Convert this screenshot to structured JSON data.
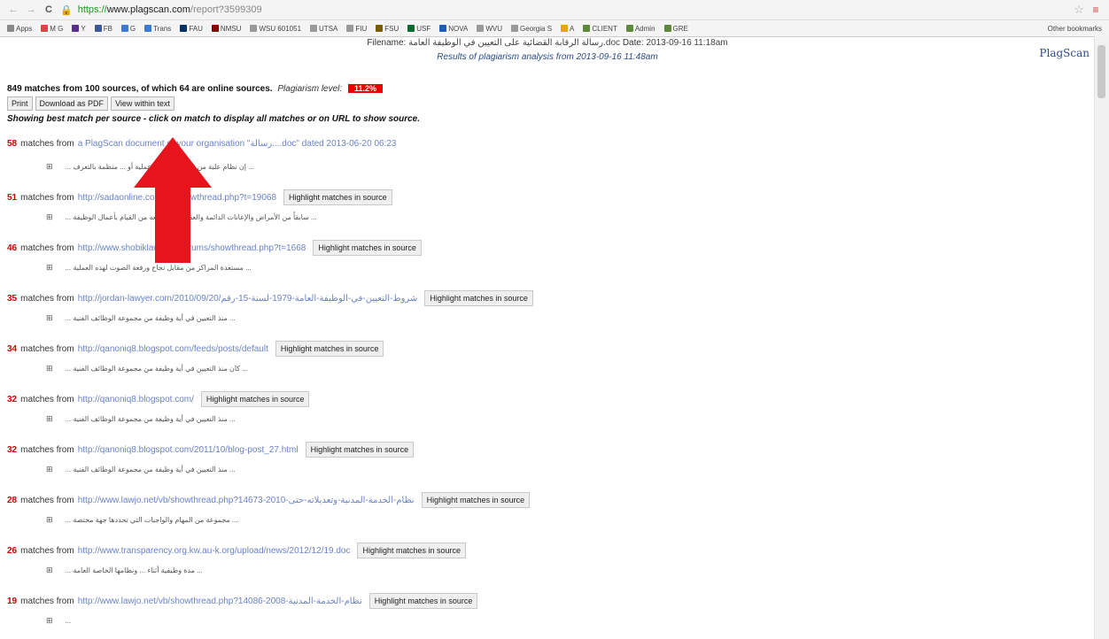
{
  "browser": {
    "url_proto": "https://",
    "url_host": "www.plagscan.com",
    "url_path": "/report?3599309",
    "bookmarks": [
      {
        "label": "Apps",
        "color": "#888"
      },
      {
        "label": "M G",
        "color": "#d44"
      },
      {
        "label": "Y",
        "color": "#5a2d91"
      },
      {
        "label": "FB",
        "color": "#3b5998"
      },
      {
        "label": "G",
        "color": "#3b7bd4"
      },
      {
        "label": "Trans",
        "color": "#3b7bd4"
      },
      {
        "label": "FAU",
        "color": "#003366"
      },
      {
        "label": "NMSU",
        "color": "#8b0000"
      },
      {
        "label": "WSU 601051",
        "color": "#999"
      },
      {
        "label": "UTSA",
        "color": "#999"
      },
      {
        "label": "FIU",
        "color": "#999"
      },
      {
        "label": "FSU",
        "color": "#7a5c00"
      },
      {
        "label": "USF",
        "color": "#0a6b2e"
      },
      {
        "label": "NOVA",
        "color": "#1a5fb4"
      },
      {
        "label": "WVU",
        "color": "#999"
      },
      {
        "label": "Georgia S",
        "color": "#999"
      },
      {
        "label": "A",
        "color": "#e8a317"
      },
      {
        "label": "CLIENT",
        "color": "#5c8a3a"
      },
      {
        "label": "Admin",
        "color": "#5c8a3a"
      },
      {
        "label": "GRE",
        "color": "#5c8a3a"
      }
    ],
    "other_bookmarks": "Other bookmarks"
  },
  "header": {
    "filename_label": "Filename:",
    "filename": "رسالة الرقابة القضائية على التعيين في الوظيفة العامة.doc",
    "date_label": "Date:",
    "date": "2013-09-16 11:18am",
    "results": "Results of plagiarism analysis from 2013-09-16 11:48am",
    "logo": "PlagScan"
  },
  "summary": {
    "text": "849 matches from 100 sources, of which 64 are online sources.",
    "plagiarism_label": "Plagiarism level:",
    "plagiarism_level": "11.2%"
  },
  "buttons": {
    "print": "Print",
    "download": "Download as PDF",
    "view": "View within text"
  },
  "instruction": "Showing best match per source - click on match to display all matches or on URL to show source.",
  "matches_from_label": "matches from",
  "highlight_label": "Highlight matches in source",
  "matches": [
    {
      "count": "58",
      "source": "a PlagScan document of your organisation \"رسالة....doc\" dated 2013-06-20 06:23",
      "has_button": false,
      "snippet": "... إن نظام علبة من منظمة ... التي عملية أو ... منظمة بالتعرف ..."
    },
    {
      "count": "51",
      "source": "http://sadaonline.com/vb/showthread.php?t=19068",
      "has_button": true,
      "snippet": "... سابقاً من الأمراض والإعانات الدائمة والعقلية التي تمنعه من القيام بأعمال الوظيفة ..."
    },
    {
      "count": "46",
      "source": "http://www.shobiklaw.com/forums/showthread.php?t=1668",
      "has_button": true,
      "snippet": "... مستعدة المراكز من مقابل نجاح ورفعة الصوت لهذه العملية ..."
    },
    {
      "count": "35",
      "source": "http://jordan-lawyer.com/2010/09/20/شروط-التعيين-في-الوظيفة-العامة-1979-لسنة-15-رقم",
      "has_button": true,
      "snippet": "... منذ التعيين في أية وظيفة من مجموعة الوظائف الفنية ..."
    },
    {
      "count": "34",
      "source": "http://qanoniq8.blogspot.com/feeds/posts/default",
      "has_button": true,
      "snippet": "... كان منذ التعيين في أية وظيفة من مجموعة الوظائف الفنية ..."
    },
    {
      "count": "32",
      "source": "http://qanoniq8.blogspot.com/",
      "has_button": true,
      "snippet": "... منذ التعيين في أية وظيفة من مجموعة الوظائف الفنية ..."
    },
    {
      "count": "32",
      "source": "http://qanoniq8.blogspot.com/2011/10/blog-post_27.html",
      "has_button": true,
      "snippet": "... منذ التعيين في أية وظيفة من مجموعة الوظائف الفنية ..."
    },
    {
      "count": "28",
      "source": "http://www.lawjo.net/vb/showthread.php?14673-2010-نظام-الخدمة-المدنية-وتعديلاته-حتى",
      "has_button": true,
      "snippet": "... مجموعة من المهام والواجبات التي تحددها جهة مختصة ..."
    },
    {
      "count": "26",
      "source": "http://www.transparency.org.kw.au-k.org/upload/news/2012/12/19.doc",
      "has_button": true,
      "snippet": "... مدة وظيفية أثناء ... ونظامها الخاصة العامة ..."
    },
    {
      "count": "19",
      "source": "http://www.lawjo.net/vb/showthread.php?14086-2008-نظام-الخدمة-المدنية",
      "has_button": true,
      "snippet": "..."
    }
  ]
}
